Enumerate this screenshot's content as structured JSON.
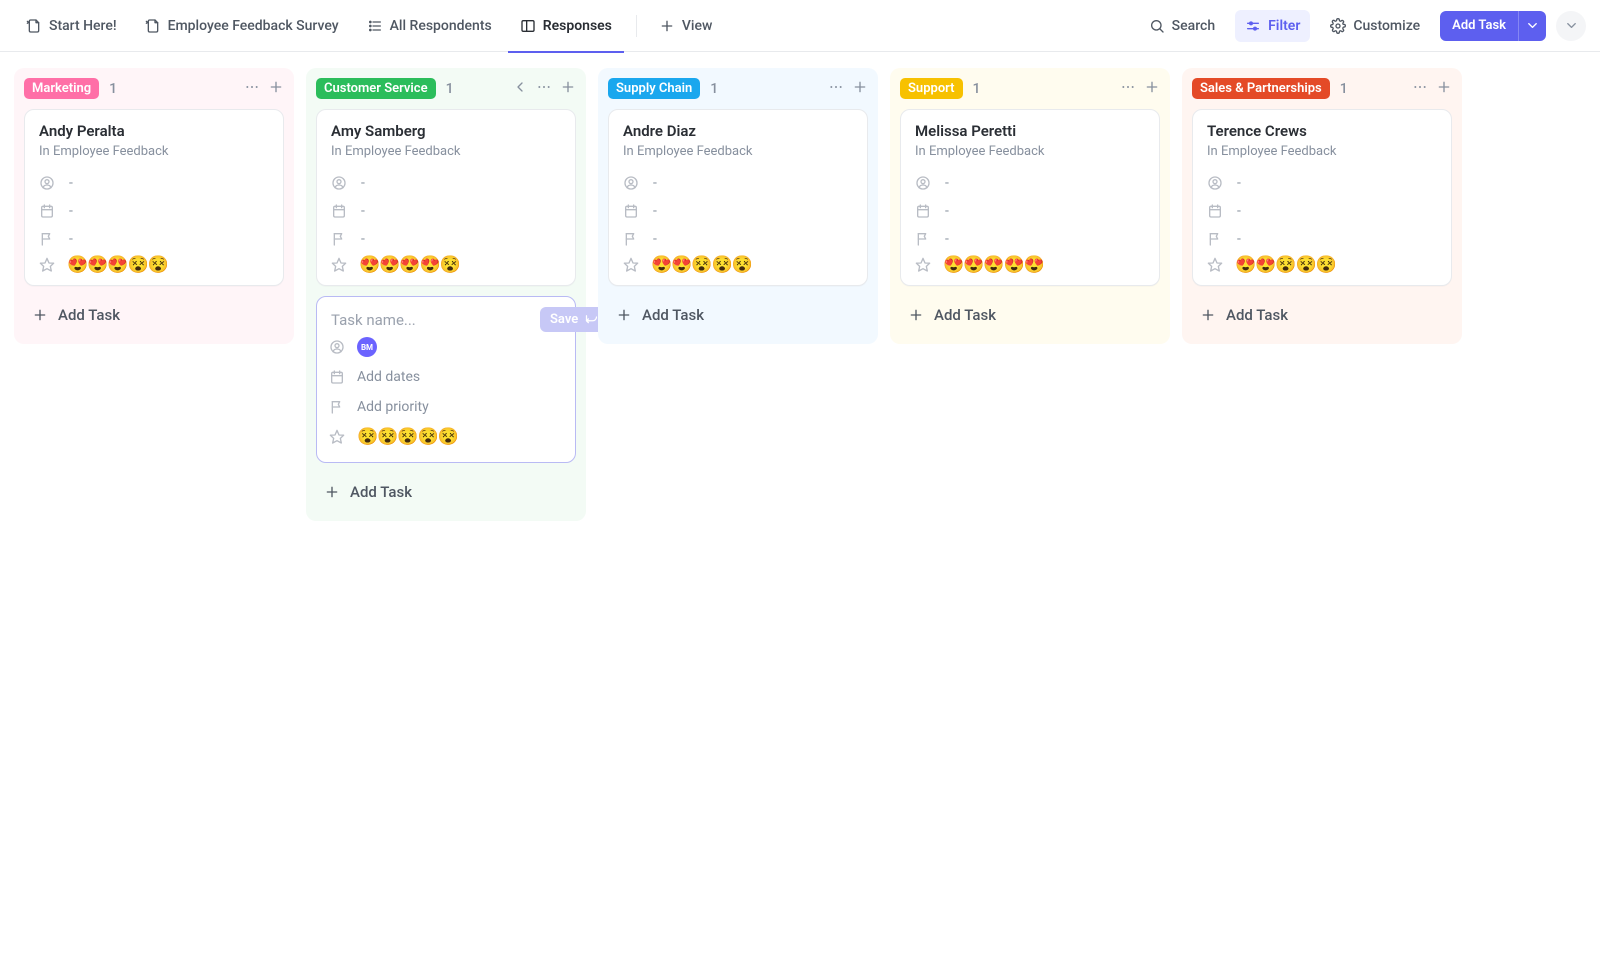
{
  "toolbar": {
    "tabs": [
      {
        "label": "Start Here!",
        "icon": "doc-pin-icon"
      },
      {
        "label": "Employee Feedback Survey",
        "icon": "doc-pin-icon"
      },
      {
        "label": "All Respondents",
        "icon": "list-icon"
      },
      {
        "label": "Responses",
        "icon": "board-icon",
        "active": true
      }
    ],
    "add_view_label": "View",
    "search_label": "Search",
    "filter_label": "Filter",
    "customize_label": "Customize",
    "add_task_label": "Add Task"
  },
  "new_task": {
    "placeholder": "Task name...",
    "save_label": "Save",
    "assignee_initials": "BM",
    "add_dates_label": "Add dates",
    "add_priority_label": "Add priority",
    "rating_filled": 0,
    "rating_total": 5
  },
  "columns": [
    {
      "id": "marketing",
      "label": "Marketing",
      "pill_color": "#ff6fa7",
      "bg_color": "#fff5f8",
      "count": 1,
      "show_back": false,
      "cards": [
        {
          "title": "Andy Peralta",
          "sub": "In Employee Feedback",
          "rating_filled": 3,
          "rating_total": 5
        }
      ],
      "add_task_label": "Add Task",
      "has_new_task": false
    },
    {
      "id": "customer-service",
      "label": "Customer Service",
      "pill_color": "#2bbd5b",
      "bg_color": "#f3fbf5",
      "count": 1,
      "show_back": true,
      "cards": [
        {
          "title": "Amy Samberg",
          "sub": "In Employee Feedback",
          "rating_filled": 4,
          "rating_total": 5
        }
      ],
      "add_task_label": "Add Task",
      "has_new_task": true
    },
    {
      "id": "supply-chain",
      "label": "Supply Chain",
      "pill_color": "#1aa7ee",
      "bg_color": "#f2f9ff",
      "count": 1,
      "show_back": false,
      "cards": [
        {
          "title": "Andre Diaz",
          "sub": "In Employee Feedback",
          "rating_filled": 2,
          "rating_total": 5
        }
      ],
      "add_task_label": "Add Task",
      "has_new_task": false
    },
    {
      "id": "support",
      "label": "Support",
      "pill_color": "#f7c100",
      "bg_color": "#fffcef",
      "count": 1,
      "show_back": false,
      "cards": [
        {
          "title": "Melissa Peretti",
          "sub": "In Employee Feedback",
          "rating_filled": 5,
          "rating_total": 5
        }
      ],
      "add_task_label": "Add Task",
      "has_new_task": false
    },
    {
      "id": "sales-partnerships",
      "label": "Sales & Partnerships",
      "pill_color": "#e44a27",
      "bg_color": "#fff5f1",
      "count": 1,
      "show_back": false,
      "cards": [
        {
          "title": "Terence Crews",
          "sub": "In Employee Feedback",
          "rating_filled": 2,
          "rating_total": 5
        }
      ],
      "add_task_label": "Add Task",
      "has_new_task": false
    }
  ]
}
